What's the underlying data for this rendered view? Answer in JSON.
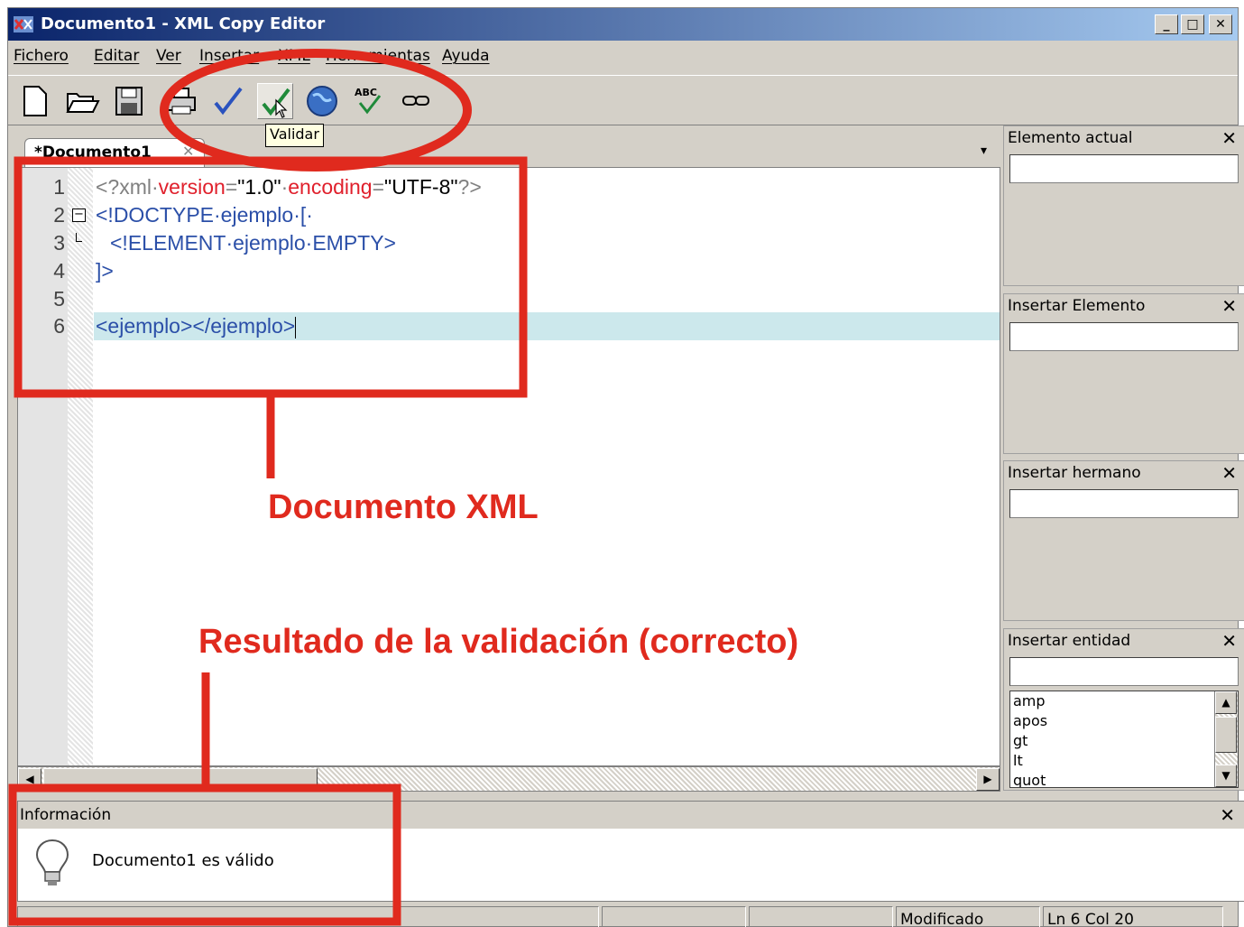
{
  "window": {
    "title": "Documento1 - XML Copy Editor",
    "minimize": "_",
    "maximize": "□",
    "close": "✕"
  },
  "menu": [
    {
      "label": "Fichero"
    },
    {
      "label": "Editar"
    },
    {
      "label": "Ver"
    },
    {
      "label": "Insertar"
    },
    {
      "label": "XML"
    },
    {
      "label": "Herramientas"
    },
    {
      "label": "Ayuda"
    }
  ],
  "toolbar": {
    "buttons": [
      "new-document-icon",
      "open-folder-icon",
      "save-icon",
      "print-icon",
      "check-wellformed-icon",
      "validate-icon",
      "globe-icon",
      "spellcheck-icon",
      "link-icon"
    ],
    "tooltip": "Validar"
  },
  "tab": {
    "label": "*Documento1",
    "close": "✕",
    "menu_arrow": "▾"
  },
  "editor": {
    "line_numbers": [
      "1",
      "2",
      "3",
      "4",
      "5",
      "6"
    ],
    "current_line": 6
  },
  "panels": [
    {
      "title": "Elemento actual",
      "close": "✕"
    },
    {
      "title": "Insertar Elemento",
      "close": "✕"
    },
    {
      "title": "Insertar hermano",
      "close": "✕"
    },
    {
      "title": "Insertar entidad",
      "close": "✕",
      "entities": [
        "amp",
        "apos",
        "gt",
        "lt",
        "quot"
      ]
    }
  ],
  "info": {
    "title": "Información",
    "close": "✕",
    "message": "Documento1 es válido"
  },
  "status": {
    "state": "Modificado",
    "position": "Ln 6 Col 20"
  },
  "annotations": {
    "document_label": "Documento XML",
    "result_label": "Resultado de la validación (correcto)",
    "color": "#e02a1e"
  }
}
